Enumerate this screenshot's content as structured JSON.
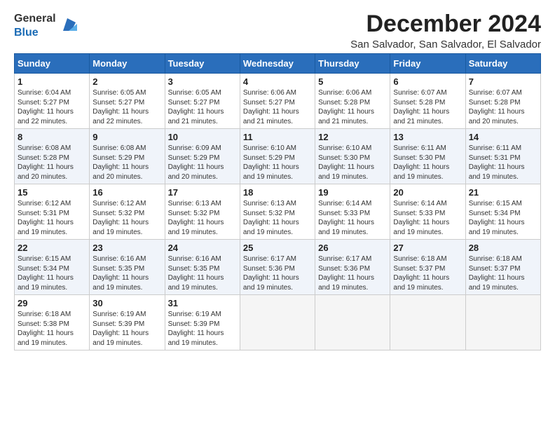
{
  "header": {
    "logo_general": "General",
    "logo_blue": "Blue",
    "month_title": "December 2024",
    "location": "San Salvador, San Salvador, El Salvador"
  },
  "days_of_week": [
    "Sunday",
    "Monday",
    "Tuesday",
    "Wednesday",
    "Thursday",
    "Friday",
    "Saturday"
  ],
  "weeks": [
    [
      {
        "day": "1",
        "info": "Sunrise: 6:04 AM\nSunset: 5:27 PM\nDaylight: 11 hours\nand 22 minutes."
      },
      {
        "day": "2",
        "info": "Sunrise: 6:05 AM\nSunset: 5:27 PM\nDaylight: 11 hours\nand 22 minutes."
      },
      {
        "day": "3",
        "info": "Sunrise: 6:05 AM\nSunset: 5:27 PM\nDaylight: 11 hours\nand 21 minutes."
      },
      {
        "day": "4",
        "info": "Sunrise: 6:06 AM\nSunset: 5:27 PM\nDaylight: 11 hours\nand 21 minutes."
      },
      {
        "day": "5",
        "info": "Sunrise: 6:06 AM\nSunset: 5:28 PM\nDaylight: 11 hours\nand 21 minutes."
      },
      {
        "day": "6",
        "info": "Sunrise: 6:07 AM\nSunset: 5:28 PM\nDaylight: 11 hours\nand 21 minutes."
      },
      {
        "day": "7",
        "info": "Sunrise: 6:07 AM\nSunset: 5:28 PM\nDaylight: 11 hours\nand 20 minutes."
      }
    ],
    [
      {
        "day": "8",
        "info": "Sunrise: 6:08 AM\nSunset: 5:28 PM\nDaylight: 11 hours\nand 20 minutes."
      },
      {
        "day": "9",
        "info": "Sunrise: 6:08 AM\nSunset: 5:29 PM\nDaylight: 11 hours\nand 20 minutes."
      },
      {
        "day": "10",
        "info": "Sunrise: 6:09 AM\nSunset: 5:29 PM\nDaylight: 11 hours\nand 20 minutes."
      },
      {
        "day": "11",
        "info": "Sunrise: 6:10 AM\nSunset: 5:29 PM\nDaylight: 11 hours\nand 19 minutes."
      },
      {
        "day": "12",
        "info": "Sunrise: 6:10 AM\nSunset: 5:30 PM\nDaylight: 11 hours\nand 19 minutes."
      },
      {
        "day": "13",
        "info": "Sunrise: 6:11 AM\nSunset: 5:30 PM\nDaylight: 11 hours\nand 19 minutes."
      },
      {
        "day": "14",
        "info": "Sunrise: 6:11 AM\nSunset: 5:31 PM\nDaylight: 11 hours\nand 19 minutes."
      }
    ],
    [
      {
        "day": "15",
        "info": "Sunrise: 6:12 AM\nSunset: 5:31 PM\nDaylight: 11 hours\nand 19 minutes."
      },
      {
        "day": "16",
        "info": "Sunrise: 6:12 AM\nSunset: 5:32 PM\nDaylight: 11 hours\nand 19 minutes."
      },
      {
        "day": "17",
        "info": "Sunrise: 6:13 AM\nSunset: 5:32 PM\nDaylight: 11 hours\nand 19 minutes."
      },
      {
        "day": "18",
        "info": "Sunrise: 6:13 AM\nSunset: 5:32 PM\nDaylight: 11 hours\nand 19 minutes."
      },
      {
        "day": "19",
        "info": "Sunrise: 6:14 AM\nSunset: 5:33 PM\nDaylight: 11 hours\nand 19 minutes."
      },
      {
        "day": "20",
        "info": "Sunrise: 6:14 AM\nSunset: 5:33 PM\nDaylight: 11 hours\nand 19 minutes."
      },
      {
        "day": "21",
        "info": "Sunrise: 6:15 AM\nSunset: 5:34 PM\nDaylight: 11 hours\nand 19 minutes."
      }
    ],
    [
      {
        "day": "22",
        "info": "Sunrise: 6:15 AM\nSunset: 5:34 PM\nDaylight: 11 hours\nand 19 minutes."
      },
      {
        "day": "23",
        "info": "Sunrise: 6:16 AM\nSunset: 5:35 PM\nDaylight: 11 hours\nand 19 minutes."
      },
      {
        "day": "24",
        "info": "Sunrise: 6:16 AM\nSunset: 5:35 PM\nDaylight: 11 hours\nand 19 minutes."
      },
      {
        "day": "25",
        "info": "Sunrise: 6:17 AM\nSunset: 5:36 PM\nDaylight: 11 hours\nand 19 minutes."
      },
      {
        "day": "26",
        "info": "Sunrise: 6:17 AM\nSunset: 5:36 PM\nDaylight: 11 hours\nand 19 minutes."
      },
      {
        "day": "27",
        "info": "Sunrise: 6:18 AM\nSunset: 5:37 PM\nDaylight: 11 hours\nand 19 minutes."
      },
      {
        "day": "28",
        "info": "Sunrise: 6:18 AM\nSunset: 5:37 PM\nDaylight: 11 hours\nand 19 minutes."
      }
    ],
    [
      {
        "day": "29",
        "info": "Sunrise: 6:18 AM\nSunset: 5:38 PM\nDaylight: 11 hours\nand 19 minutes."
      },
      {
        "day": "30",
        "info": "Sunrise: 6:19 AM\nSunset: 5:39 PM\nDaylight: 11 hours\nand 19 minutes."
      },
      {
        "day": "31",
        "info": "Sunrise: 6:19 AM\nSunset: 5:39 PM\nDaylight: 11 hours\nand 19 minutes."
      },
      {
        "day": "",
        "info": ""
      },
      {
        "day": "",
        "info": ""
      },
      {
        "day": "",
        "info": ""
      },
      {
        "day": "",
        "info": ""
      }
    ]
  ]
}
